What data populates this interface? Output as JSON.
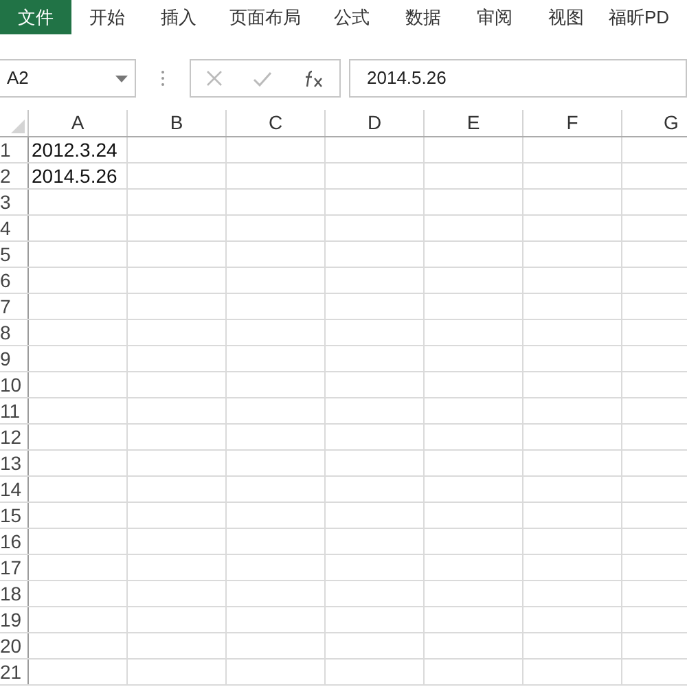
{
  "ribbon_tabs": [
    {
      "label": "文件",
      "selected": true
    },
    {
      "label": "开始",
      "selected": false
    },
    {
      "label": "插入",
      "selected": false
    },
    {
      "label": "页面布局",
      "selected": false
    },
    {
      "label": "公式",
      "selected": false
    },
    {
      "label": "数据",
      "selected": false
    },
    {
      "label": "审阅",
      "selected": false
    },
    {
      "label": "视图",
      "selected": false
    },
    {
      "label": "福昕PD",
      "selected": false
    }
  ],
  "name_box": {
    "value": "A2"
  },
  "formula_bar": {
    "value": "2014.5.26"
  },
  "columns": [
    "A",
    "B",
    "C",
    "D",
    "E",
    "F",
    "G"
  ],
  "rows": [
    {
      "number": "1",
      "cells": [
        "2012.3.24"
      ]
    },
    {
      "number": "2",
      "cells": [
        "2014.5.26"
      ]
    },
    {
      "number": "3",
      "cells": []
    },
    {
      "number": "4",
      "cells": []
    },
    {
      "number": "5",
      "cells": []
    },
    {
      "number": "6",
      "cells": []
    },
    {
      "number": "7",
      "cells": []
    },
    {
      "number": "8",
      "cells": []
    },
    {
      "number": "9",
      "cells": []
    },
    {
      "number": "10",
      "cells": []
    },
    {
      "number": "11",
      "cells": []
    },
    {
      "number": "12",
      "cells": []
    },
    {
      "number": "13",
      "cells": []
    },
    {
      "number": "14",
      "cells": []
    },
    {
      "number": "15",
      "cells": []
    },
    {
      "number": "16",
      "cells": []
    },
    {
      "number": "17",
      "cells": []
    },
    {
      "number": "18",
      "cells": []
    },
    {
      "number": "19",
      "cells": []
    },
    {
      "number": "20",
      "cells": []
    },
    {
      "number": "21",
      "cells": []
    }
  ]
}
